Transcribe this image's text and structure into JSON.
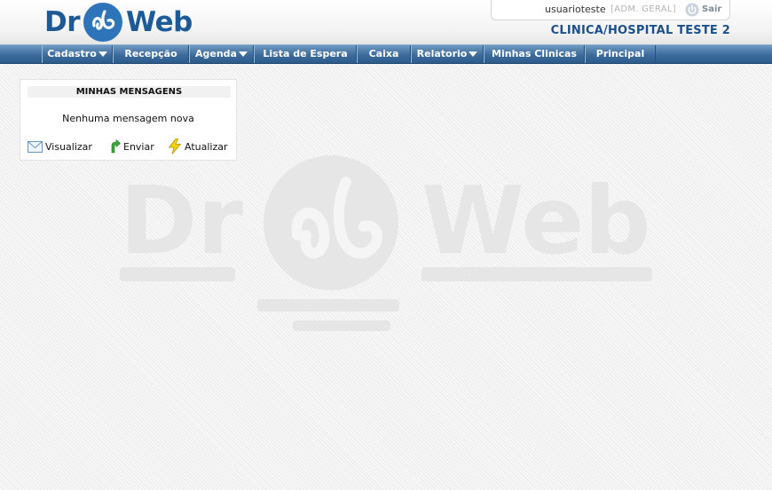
{
  "header": {
    "logo": {
      "left": "Dr",
      "right": "Web"
    },
    "user": {
      "name": "usuarioteste",
      "role": "[ADM. GERAL]",
      "logout_label": "Sair"
    },
    "clinic_name": "CLINICA/HOSPITAL TESTE 2"
  },
  "nav": {
    "items": [
      {
        "label": "Cadastro",
        "dropdown": true
      },
      {
        "label": "Recepção",
        "dropdown": false
      },
      {
        "label": "Agenda",
        "dropdown": true
      },
      {
        "label": "Lista de Espera",
        "dropdown": false
      },
      {
        "label": "Caixa",
        "dropdown": false
      },
      {
        "label": "Relatorio",
        "dropdown": true
      },
      {
        "label": "Minhas Clinicas",
        "dropdown": false
      },
      {
        "label": "Principal",
        "dropdown": false
      }
    ]
  },
  "messages": {
    "title": "MINHAS MENSAGENS",
    "empty_text": "Nenhuma mensagem nova",
    "actions": [
      {
        "label": "Visualizar",
        "icon": "envelope-icon"
      },
      {
        "label": "Enviar",
        "icon": "green-arrow-icon"
      },
      {
        "label": "Atualizar",
        "icon": "lightning-icon"
      }
    ]
  },
  "colors": {
    "brand_blue": "#2d74b9",
    "nav_blue": "#3d6c9c",
    "clinic_text": "#1d4f8f"
  }
}
